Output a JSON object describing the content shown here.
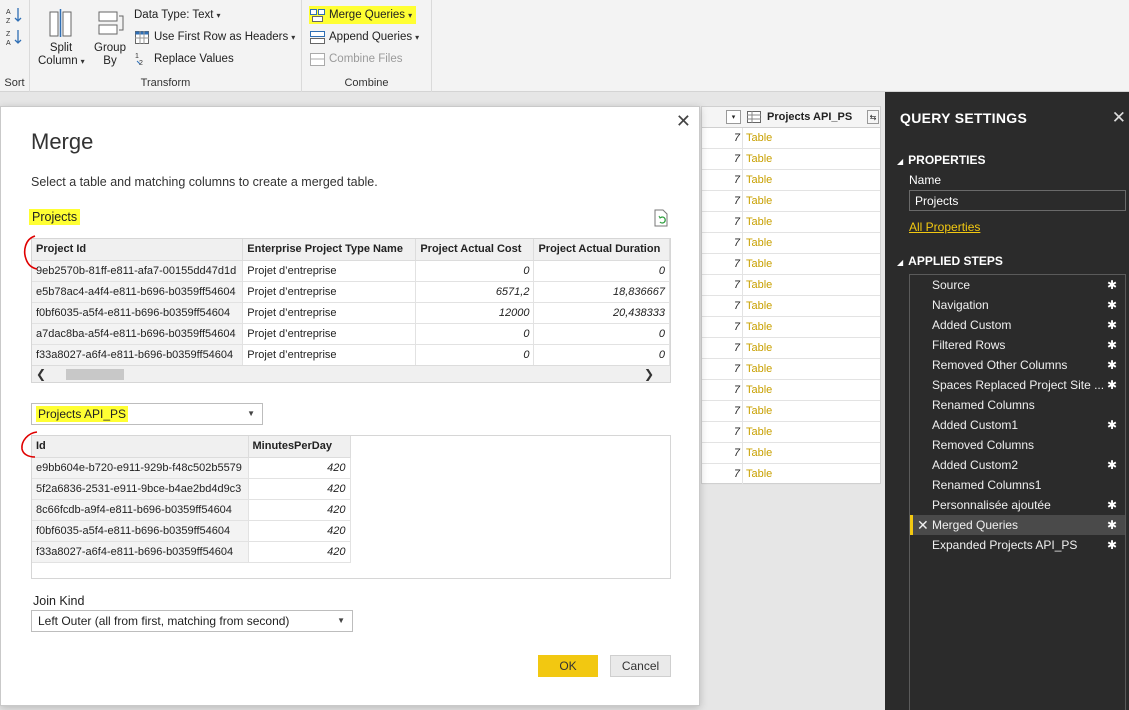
{
  "ribbon": {
    "sort": {
      "label": "Sort"
    },
    "transform": {
      "label": "Transform",
      "split_column": "Split Column",
      "group_by": "Group By",
      "data_type": "Data Type: Text",
      "first_row_headers": "Use First Row as Headers",
      "replace_values": "Replace Values"
    },
    "combine": {
      "label": "Combine",
      "merge_queries": "Merge Queries",
      "append_queries": "Append Queries",
      "combine_files": "Combine Files"
    }
  },
  "background_grid": {
    "column_name": "Projects API_PS",
    "rows": [
      {
        "num": "7",
        "val": "Table"
      },
      {
        "num": "7",
        "val": "Table"
      },
      {
        "num": "7",
        "val": "Table"
      },
      {
        "num": "7",
        "val": "Table"
      },
      {
        "num": "7",
        "val": "Table"
      },
      {
        "num": "7",
        "val": "Table"
      },
      {
        "num": "7",
        "val": "Table"
      },
      {
        "num": "7",
        "val": "Table"
      },
      {
        "num": "7",
        "val": "Table"
      },
      {
        "num": "7",
        "val": "Table"
      },
      {
        "num": "7",
        "val": "Table"
      },
      {
        "num": "7",
        "val": "Table"
      },
      {
        "num": "7",
        "val": "Table"
      },
      {
        "num": "7",
        "val": "Table"
      },
      {
        "num": "7",
        "val": "Table"
      },
      {
        "num": "7",
        "val": "Table"
      },
      {
        "num": "7",
        "val": "Table"
      }
    ]
  },
  "query_settings": {
    "title": "QUERY SETTINGS",
    "properties_label": "PROPERTIES",
    "name_label": "Name",
    "name_value": "Projects",
    "all_properties": "All Properties",
    "applied_steps_label": "APPLIED STEPS",
    "steps": [
      {
        "label": "Source",
        "gear": true,
        "active": false
      },
      {
        "label": "Navigation",
        "gear": true,
        "active": false
      },
      {
        "label": "Added Custom",
        "gear": true,
        "active": false
      },
      {
        "label": "Filtered Rows",
        "gear": true,
        "active": false
      },
      {
        "label": "Removed Other Columns",
        "gear": true,
        "active": false
      },
      {
        "label": "Spaces Replaced Project Site ...",
        "gear": true,
        "active": false
      },
      {
        "label": "Renamed Columns",
        "gear": false,
        "active": false
      },
      {
        "label": "Added Custom1",
        "gear": true,
        "active": false
      },
      {
        "label": "Removed Columns",
        "gear": false,
        "active": false
      },
      {
        "label": "Added Custom2",
        "gear": true,
        "active": false
      },
      {
        "label": "Renamed Columns1",
        "gear": false,
        "active": false
      },
      {
        "label": "Personnalisée ajoutée",
        "gear": true,
        "active": false
      },
      {
        "label": "Merged Queries",
        "gear": true,
        "active": true
      },
      {
        "label": "Expanded Projects API_PS",
        "gear": true,
        "active": false
      }
    ]
  },
  "merge": {
    "title": "Merge",
    "description": "Select a table and matching columns to create a merged table.",
    "first_table_name": "Projects",
    "first_table": {
      "columns": [
        "Project Id",
        "Enterprise Project Type Name",
        "Project Actual Cost",
        "Project Actual Duration"
      ],
      "rows": [
        [
          "9eb2570b-81ff-e811-afa7-00155dd47d1d",
          "Projet d’entreprise",
          "0",
          "0"
        ],
        [
          "e5b78ac4-a4f4-e811-b696-b0359ff54604",
          "Projet d’entreprise",
          "6571,2",
          "18,836667"
        ],
        [
          "f0bf6035-a5f4-e811-b696-b0359ff54604",
          "Projet d’entreprise",
          "12000",
          "20,438333"
        ],
        [
          "a7dac8ba-a5f4-e811-b696-b0359ff54604",
          "Projet d’entreprise",
          "0",
          "0"
        ],
        [
          "f33a8027-a6f4-e811-b696-b0359ff54604",
          "Projet d’entreprise",
          "0",
          "0"
        ]
      ]
    },
    "second_table_name": "Projects API_PS",
    "second_table": {
      "columns": [
        "Id",
        "MinutesPerDay"
      ],
      "rows": [
        [
          "e9bb604e-b720-e911-929b-f48c502b5579",
          "420"
        ],
        [
          "5f2a6836-2531-e911-9bce-b4ae2bd4d9c3",
          "420"
        ],
        [
          "8c66fcdb-a9f4-e811-b696-b0359ff54604",
          "420"
        ],
        [
          "f0bf6035-a5f4-e811-b696-b0359ff54604",
          "420"
        ],
        [
          "f33a8027-a6f4-e811-b696-b0359ff54604",
          "420"
        ]
      ]
    },
    "join_kind_label": "Join Kind",
    "join_kind_value": "Left Outer (all from first, matching from second)",
    "ok_label": "OK",
    "cancel_label": "Cancel"
  },
  "colors": {
    "accent_yellow": "#f2c811",
    "highlight": "#ffff33",
    "annotation_red": "#e00000",
    "panel_dark": "#2b2b2b"
  }
}
